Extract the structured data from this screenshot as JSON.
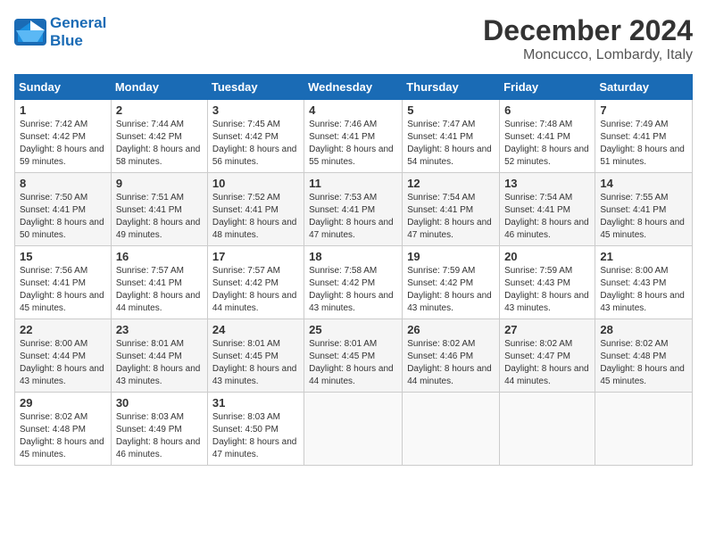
{
  "header": {
    "logo_line1": "General",
    "logo_line2": "Blue",
    "month_title": "December 2024",
    "location": "Moncucco, Lombardy, Italy"
  },
  "days_of_week": [
    "Sunday",
    "Monday",
    "Tuesday",
    "Wednesday",
    "Thursday",
    "Friday",
    "Saturday"
  ],
  "weeks": [
    [
      {
        "day": "1",
        "sunrise": "7:42 AM",
        "sunset": "4:42 PM",
        "daylight": "8 hours and 59 minutes."
      },
      {
        "day": "2",
        "sunrise": "7:44 AM",
        "sunset": "4:42 PM",
        "daylight": "8 hours and 58 minutes."
      },
      {
        "day": "3",
        "sunrise": "7:45 AM",
        "sunset": "4:42 PM",
        "daylight": "8 hours and 56 minutes."
      },
      {
        "day": "4",
        "sunrise": "7:46 AM",
        "sunset": "4:41 PM",
        "daylight": "8 hours and 55 minutes."
      },
      {
        "day": "5",
        "sunrise": "7:47 AM",
        "sunset": "4:41 PM",
        "daylight": "8 hours and 54 minutes."
      },
      {
        "day": "6",
        "sunrise": "7:48 AM",
        "sunset": "4:41 PM",
        "daylight": "8 hours and 52 minutes."
      },
      {
        "day": "7",
        "sunrise": "7:49 AM",
        "sunset": "4:41 PM",
        "daylight": "8 hours and 51 minutes."
      }
    ],
    [
      {
        "day": "8",
        "sunrise": "7:50 AM",
        "sunset": "4:41 PM",
        "daylight": "8 hours and 50 minutes."
      },
      {
        "day": "9",
        "sunrise": "7:51 AM",
        "sunset": "4:41 PM",
        "daylight": "8 hours and 49 minutes."
      },
      {
        "day": "10",
        "sunrise": "7:52 AM",
        "sunset": "4:41 PM",
        "daylight": "8 hours and 48 minutes."
      },
      {
        "day": "11",
        "sunrise": "7:53 AM",
        "sunset": "4:41 PM",
        "daylight": "8 hours and 47 minutes."
      },
      {
        "day": "12",
        "sunrise": "7:54 AM",
        "sunset": "4:41 PM",
        "daylight": "8 hours and 47 minutes."
      },
      {
        "day": "13",
        "sunrise": "7:54 AM",
        "sunset": "4:41 PM",
        "daylight": "8 hours and 46 minutes."
      },
      {
        "day": "14",
        "sunrise": "7:55 AM",
        "sunset": "4:41 PM",
        "daylight": "8 hours and 45 minutes."
      }
    ],
    [
      {
        "day": "15",
        "sunrise": "7:56 AM",
        "sunset": "4:41 PM",
        "daylight": "8 hours and 45 minutes."
      },
      {
        "day": "16",
        "sunrise": "7:57 AM",
        "sunset": "4:41 PM",
        "daylight": "8 hours and 44 minutes."
      },
      {
        "day": "17",
        "sunrise": "7:57 AM",
        "sunset": "4:42 PM",
        "daylight": "8 hours and 44 minutes."
      },
      {
        "day": "18",
        "sunrise": "7:58 AM",
        "sunset": "4:42 PM",
        "daylight": "8 hours and 43 minutes."
      },
      {
        "day": "19",
        "sunrise": "7:59 AM",
        "sunset": "4:42 PM",
        "daylight": "8 hours and 43 minutes."
      },
      {
        "day": "20",
        "sunrise": "7:59 AM",
        "sunset": "4:43 PM",
        "daylight": "8 hours and 43 minutes."
      },
      {
        "day": "21",
        "sunrise": "8:00 AM",
        "sunset": "4:43 PM",
        "daylight": "8 hours and 43 minutes."
      }
    ],
    [
      {
        "day": "22",
        "sunrise": "8:00 AM",
        "sunset": "4:44 PM",
        "daylight": "8 hours and 43 minutes."
      },
      {
        "day": "23",
        "sunrise": "8:01 AM",
        "sunset": "4:44 PM",
        "daylight": "8 hours and 43 minutes."
      },
      {
        "day": "24",
        "sunrise": "8:01 AM",
        "sunset": "4:45 PM",
        "daylight": "8 hours and 43 minutes."
      },
      {
        "day": "25",
        "sunrise": "8:01 AM",
        "sunset": "4:45 PM",
        "daylight": "8 hours and 44 minutes."
      },
      {
        "day": "26",
        "sunrise": "8:02 AM",
        "sunset": "4:46 PM",
        "daylight": "8 hours and 44 minutes."
      },
      {
        "day": "27",
        "sunrise": "8:02 AM",
        "sunset": "4:47 PM",
        "daylight": "8 hours and 44 minutes."
      },
      {
        "day": "28",
        "sunrise": "8:02 AM",
        "sunset": "4:48 PM",
        "daylight": "8 hours and 45 minutes."
      }
    ],
    [
      {
        "day": "29",
        "sunrise": "8:02 AM",
        "sunset": "4:48 PM",
        "daylight": "8 hours and 45 minutes."
      },
      {
        "day": "30",
        "sunrise": "8:03 AM",
        "sunset": "4:49 PM",
        "daylight": "8 hours and 46 minutes."
      },
      {
        "day": "31",
        "sunrise": "8:03 AM",
        "sunset": "4:50 PM",
        "daylight": "8 hours and 47 minutes."
      },
      null,
      null,
      null,
      null
    ]
  ]
}
